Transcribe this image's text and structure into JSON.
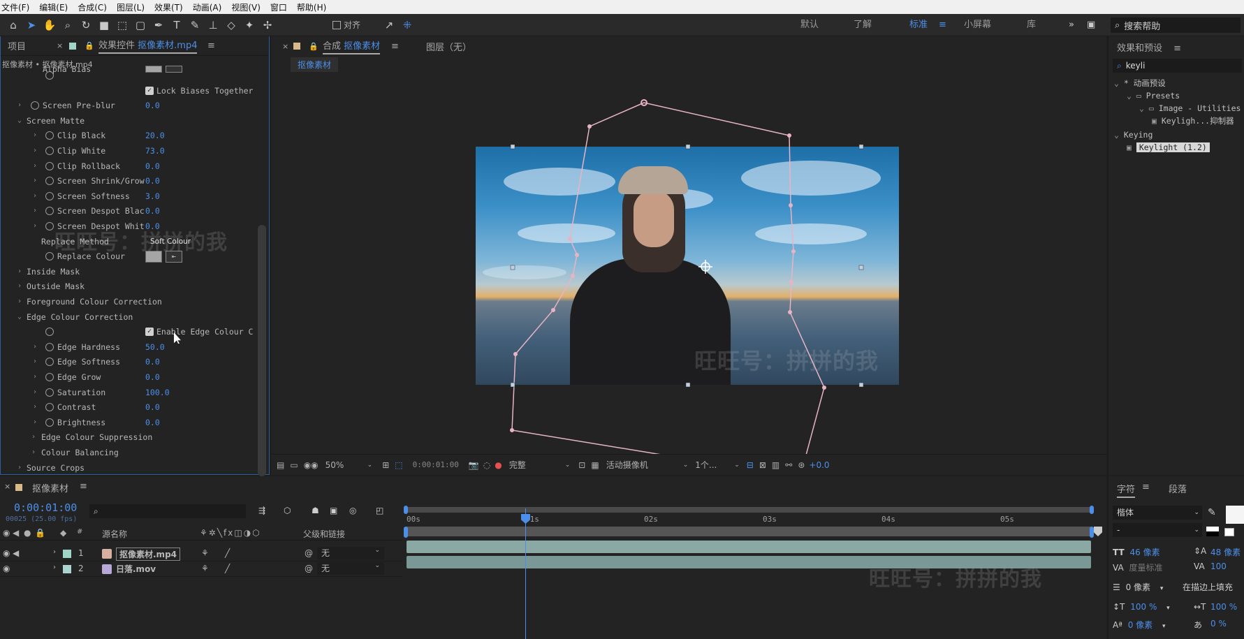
{
  "menu": [
    "文件(F)",
    "编辑(E)",
    "合成(C)",
    "图层(L)",
    "效果(T)",
    "动画(A)",
    "视图(V)",
    "窗口",
    "帮助(H)"
  ],
  "toolbar": {
    "align_label": "对齐",
    "workspaces": [
      "默认",
      "了解",
      "标准",
      "小屏幕",
      "库"
    ],
    "active_workspace": "标准",
    "search_placeholder": "搜索帮助"
  },
  "effects_panel": {
    "tab_project": "项目",
    "tab_effects_prefix": "效果控件",
    "tab_effects_file": "抠像素材.mp4",
    "breadcrumb": "抠像素材 • 抠像素材.mp4",
    "rows": [
      {
        "label": "Alpha Bias",
        "indent": 2
      },
      {
        "label": "Lock Biases Together",
        "checkbox": true
      },
      {
        "label": "Screen Pre-blur",
        "value": "0.0",
        "indent": 1
      },
      {
        "label": "Screen Matte",
        "group": true
      },
      {
        "label": "Clip Black",
        "value": "20.0",
        "indent": 2
      },
      {
        "label": "Clip White",
        "value": "73.0",
        "indent": 2
      },
      {
        "label": "Clip Rollback",
        "value": "0.0",
        "indent": 2
      },
      {
        "label": "Screen Shrink/Grow",
        "value": "0.0",
        "indent": 2
      },
      {
        "label": "Screen Softness",
        "value": "3.0",
        "indent": 2
      },
      {
        "label": "Screen Despot Blac",
        "value": "0.0",
        "indent": 2
      },
      {
        "label": "Screen Despot Whit",
        "value": "0.0",
        "indent": 2
      },
      {
        "label": "Replace Method",
        "value": "Soft Colour",
        "indent": 0
      },
      {
        "label": "Replace Colour",
        "indent": 2
      },
      {
        "label": "Inside Mask",
        "group": true
      },
      {
        "label": "Outside Mask",
        "group": true
      },
      {
        "label": "Foreground Colour Correction",
        "group": true
      },
      {
        "label": "Edge Colour Correction",
        "group": true
      },
      {
        "label": "Enable Edge Colour C",
        "checkbox": true
      },
      {
        "label": "Edge Hardness",
        "value": "50.0",
        "indent": 2
      },
      {
        "label": "Edge Softness",
        "value": "0.0",
        "indent": 2
      },
      {
        "label": "Edge Grow",
        "value": "0.0",
        "indent": 2
      },
      {
        "label": "Saturation",
        "value": "100.0",
        "indent": 2
      },
      {
        "label": "Contrast",
        "value": "0.0",
        "indent": 2
      },
      {
        "label": "Brightness",
        "value": "0.0",
        "indent": 2
      },
      {
        "label": "Edge Colour Suppression",
        "group": true
      },
      {
        "label": "Colour Balancing",
        "group": true
      },
      {
        "label": "Source Crops",
        "group": true
      }
    ]
  },
  "viewer": {
    "tab_comp_prefix": "合成",
    "tab_comp_name": "抠像素材",
    "tab_layer": "图层（无）",
    "comp_chip": "抠像素材",
    "zoom": "50%",
    "timecode": "0:00:01:00",
    "quality": "完整",
    "camera": "活动摄像机",
    "views": "1个...",
    "exposure": "+0.0"
  },
  "presets": {
    "title": "效果和预设",
    "search_value": "keyli",
    "tree": [
      {
        "label": "* 动画预设",
        "level": 0
      },
      {
        "label": "Presets",
        "level": 1,
        "folder": true
      },
      {
        "label": "Image - Utilities",
        "level": 2,
        "folder": true
      },
      {
        "label": "Keyligh...抑制器",
        "level": 3
      },
      {
        "label": "Keying",
        "level": 0
      },
      {
        "label": "Keylight (1.2)",
        "level": 1,
        "selected": true
      }
    ]
  },
  "timeline": {
    "comp_name": "抠像素材",
    "timecode": "0:00:01:00",
    "frame_info": "00025 (25.00 fps)",
    "col_source": "源名称",
    "col_parent": "父级和链接",
    "ruler": [
      "00s",
      "01s",
      "02s",
      "03s",
      "04s",
      "05s"
    ],
    "layers": [
      {
        "num": "1",
        "name": "抠像素材.mp4",
        "parent": "无",
        "selected": true
      },
      {
        "num": "2",
        "name": "日落.mov",
        "parent": "无"
      }
    ]
  },
  "character": {
    "tab_char": "字符",
    "tab_para": "段落",
    "font": "楷体",
    "style": "-",
    "size": "46 像素",
    "leading": "48 像素",
    "kerning": "度量标准",
    "tracking": "100",
    "stroke": "0 像素",
    "stroke_mode": "在描边上填充",
    "vscale": "100 %",
    "hscale": "100 %",
    "baseline": "0 像素",
    "tsume": "0 %"
  },
  "watermark": "旺旺号：拼拼的我",
  "colors": {
    "accent": "#4d8fe8",
    "mask": "#e8b4c4",
    "track": "#8aa9a5"
  }
}
